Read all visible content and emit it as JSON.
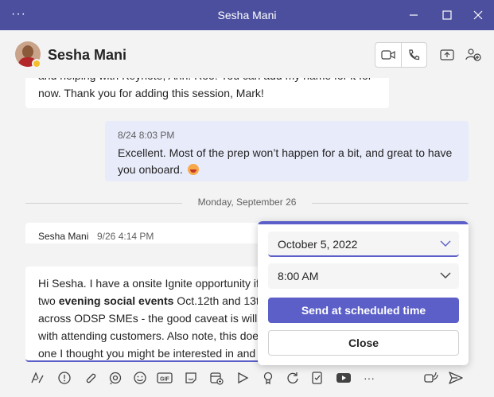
{
  "window": {
    "title": "Sesha Mani",
    "more_glyph": "···"
  },
  "header": {
    "contact_name": "Sesha Mani",
    "presence": "away",
    "icons": [
      "video-call-icon",
      "audio-call-icon",
      "share-screen-icon",
      "add-people-icon"
    ]
  },
  "messages": {
    "first_partial": {
      "line_cut": "and helping with Keynote, Ann. Roo! You can add my name for it for",
      "line2": "now. Thank you for adding this session, Mark!"
    },
    "sent": {
      "timestamp": "8/24 8:03 PM",
      "line1": "Excellent. Most of the prep won’t happen for a bit, and great to have",
      "line2": "you onboard."
    },
    "date_divider": "Monday, September 26",
    "last": {
      "sender": "Sesha Mani",
      "timestamp": "9/26 4:14 PM"
    }
  },
  "compose": {
    "l1": "Hi Sesha. I have a onsite Ignite opportunity if",
    "l2_pre": "two ",
    "l2_bold": "evening social events",
    "l2_post": " Oct.12th and 13t",
    "l3": "across ODSP SMEs - the good caveat is willin",
    "l4": "with attending customers. Also note, this doe",
    "l5": "one I thought you might be interested in and"
  },
  "schedule_popup": {
    "date_value": "October 5, 2022",
    "time_value": "8:00 AM",
    "send_button": "Send at scheduled time",
    "close_button": "Close"
  },
  "toolbar": {
    "gif_label": "GIF",
    "more_glyph": "···",
    "icons": [
      "format-icon",
      "priority-icon",
      "attach-icon",
      "loop-icon",
      "emoji-icon",
      "gif-icon",
      "sticker-icon",
      "schedule-meeting-icon",
      "stream-icon",
      "praise-icon",
      "updates-icon",
      "approvals-icon",
      "youtube-icon",
      "more-options-icon",
      "audio-message-icon",
      "send-icon"
    ]
  },
  "colors": {
    "titlebar": "#4b4f9e",
    "accent": "#5b5fc7",
    "sent_bubble": "#e8ebfa",
    "presence_away": "#f4bf2a"
  }
}
